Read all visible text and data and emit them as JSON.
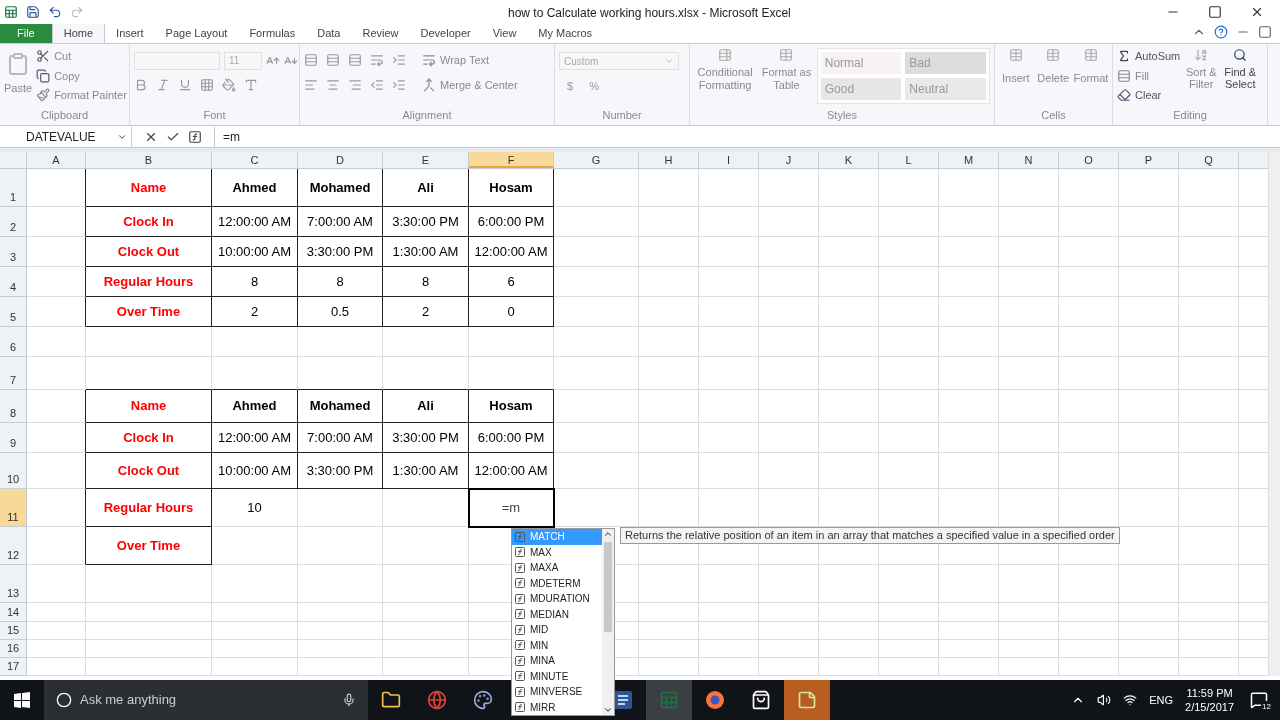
{
  "window": {
    "title": "how to Calculate working hours.xlsx - Microsoft Excel"
  },
  "tabs": [
    {
      "label": "File",
      "kind": "file",
      "selected": false
    },
    {
      "label": "Home",
      "kind": "tab",
      "selected": true
    },
    {
      "label": "Insert",
      "kind": "tab",
      "selected": false
    },
    {
      "label": "Page Layout",
      "kind": "tab",
      "selected": false
    },
    {
      "label": "Formulas",
      "kind": "tab",
      "selected": false
    },
    {
      "label": "Data",
      "kind": "tab",
      "selected": false
    },
    {
      "label": "Review",
      "kind": "tab",
      "selected": false
    },
    {
      "label": "Developer",
      "kind": "tab",
      "selected": false
    },
    {
      "label": "View",
      "kind": "tab",
      "selected": false
    },
    {
      "label": "My Macros",
      "kind": "tab",
      "selected": false
    }
  ],
  "ribbon": {
    "clipboard": {
      "label": "Clipboard",
      "paste": "Paste",
      "cut": "Cut",
      "copy": "Copy",
      "format_painter": "Format Painter"
    },
    "font": {
      "label": "Font",
      "size": "11"
    },
    "alignment": {
      "label": "Alignment",
      "wrap_text": "Wrap Text",
      "merge_center": "Merge & Center"
    },
    "number": {
      "label": "Number",
      "format": "Custom",
      "currency": "$",
      "percent": "%"
    },
    "styles": {
      "label": "Styles",
      "conditional_formatting": "Conditional Formatting",
      "format_as_table": "Format as Table",
      "cell_styles": [
        {
          "name": "Normal",
          "color": "#f8f2f2"
        },
        {
          "name": "Bad",
          "color": "#dcdcdc"
        },
        {
          "name": "Good",
          "color": "#e6e6e6"
        },
        {
          "name": "Neutral",
          "color": "#e9e9e9"
        }
      ]
    },
    "cells": {
      "label": "Cells",
      "buttons": [
        "Insert",
        "Delete",
        "Format"
      ]
    },
    "editing": {
      "label": "Editing",
      "autosum": "AutoSum",
      "fill": "Fill",
      "clear": "Clear",
      "sort_filter": "Sort & Filter",
      "find_select": "Find & Select"
    }
  },
  "formula_bar": {
    "name_box": "DATEVALUE",
    "formula": "=m"
  },
  "sheet": {
    "columns": [
      {
        "label": "A",
        "selected": false
      },
      {
        "label": "B",
        "selected": false
      },
      {
        "label": "C",
        "selected": false
      },
      {
        "label": "D",
        "selected": false
      },
      {
        "label": "E",
        "selected": false
      },
      {
        "label": "F",
        "selected": true
      },
      {
        "label": "G",
        "selected": false
      },
      {
        "label": "H",
        "selected": false
      },
      {
        "label": "I",
        "selected": false
      },
      {
        "label": "J",
        "selected": false
      },
      {
        "label": "K",
        "selected": false
      },
      {
        "label": "L",
        "selected": false
      },
      {
        "label": "M",
        "selected": false
      },
      {
        "label": "N",
        "selected": false
      },
      {
        "label": "O",
        "selected": false
      },
      {
        "label": "P",
        "selected": false
      },
      {
        "label": "Q",
        "selected": false
      }
    ],
    "rows": [
      {
        "number": "1",
        "selected": false,
        "cells": [
          {
            "kind": "none"
          },
          {
            "kind": "label",
            "text": "Name"
          },
          {
            "kind": "header",
            "text": "Ahmed"
          },
          {
            "kind": "header",
            "text": "Mohamed"
          },
          {
            "kind": "header",
            "text": "Ali"
          },
          {
            "kind": "header",
            "text": "Hosam"
          }
        ]
      },
      {
        "number": "2",
        "selected": false,
        "cells": [
          {
            "kind": "none"
          },
          {
            "kind": "label",
            "text": "Clock In"
          },
          {
            "kind": "value",
            "text": "12:00:00 AM"
          },
          {
            "kind": "value",
            "text": "7:00:00 AM"
          },
          {
            "kind": "value",
            "text": "3:30:00 PM"
          },
          {
            "kind": "value",
            "text": "6:00:00 PM"
          }
        ]
      },
      {
        "number": "3",
        "selected": false,
        "cells": [
          {
            "kind": "none"
          },
          {
            "kind": "label",
            "text": "Clock Out"
          },
          {
            "kind": "value",
            "text": "10:00:00 AM"
          },
          {
            "kind": "value",
            "text": "3:30:00 PM"
          },
          {
            "kind": "value",
            "text": "1:30:00 AM"
          },
          {
            "kind": "value",
            "text": "12:00:00 AM"
          }
        ]
      },
      {
        "number": "4",
        "selected": false,
        "cells": [
          {
            "kind": "none"
          },
          {
            "kind": "label",
            "text": "Regular Hours"
          },
          {
            "kind": "value",
            "text": "8"
          },
          {
            "kind": "value",
            "text": "8"
          },
          {
            "kind": "value",
            "text": "8"
          },
          {
            "kind": "value",
            "text": "6"
          }
        ]
      },
      {
        "number": "5",
        "selected": false,
        "cells": [
          {
            "kind": "none"
          },
          {
            "kind": "label",
            "text": "Over Time"
          },
          {
            "kind": "value",
            "text": "2"
          },
          {
            "kind": "value",
            "text": "0.5"
          },
          {
            "kind": "value",
            "text": "2"
          },
          {
            "kind": "value",
            "text": "0"
          }
        ]
      },
      {
        "number": "6",
        "selected": false,
        "cells": []
      },
      {
        "number": "7",
        "selected": false,
        "cells": []
      },
      {
        "number": "8",
        "selected": false,
        "cells": [
          {
            "kind": "none"
          },
          {
            "kind": "label",
            "text": "Name"
          },
          {
            "kind": "header",
            "text": "Ahmed"
          },
          {
            "kind": "header",
            "text": "Mohamed"
          },
          {
            "kind": "header",
            "text": "Ali"
          },
          {
            "kind": "header",
            "text": "Hosam"
          }
        ]
      },
      {
        "number": "9",
        "selected": false,
        "cells": [
          {
            "kind": "none"
          },
          {
            "kind": "label",
            "text": "Clock In"
          },
          {
            "kind": "value",
            "text": "12:00:00 AM"
          },
          {
            "kind": "value",
            "text": "7:00:00 AM"
          },
          {
            "kind": "value",
            "text": "3:30:00 PM"
          },
          {
            "kind": "value",
            "text": "6:00:00 PM"
          }
        ]
      },
      {
        "number": "10",
        "selected": false,
        "cells": [
          {
            "kind": "none"
          },
          {
            "kind": "label",
            "text": "Clock Out"
          },
          {
            "kind": "value",
            "text": "10:00:00 AM"
          },
          {
            "kind": "value",
            "text": "3:30:00 PM"
          },
          {
            "kind": "value",
            "text": "1:30:00 AM"
          },
          {
            "kind": "value",
            "text": "12:00:00 AM"
          }
        ]
      },
      {
        "number": "11",
        "selected": true,
        "cells": [
          {
            "kind": "none"
          },
          {
            "kind": "label",
            "text": "Regular Hours"
          },
          {
            "kind": "plain",
            "text": "10"
          },
          {
            "kind": "none"
          },
          {
            "kind": "none"
          },
          {
            "kind": "active",
            "text": "=m"
          }
        ]
      },
      {
        "number": "12",
        "selected": false,
        "cells": [
          {
            "kind": "none"
          },
          {
            "kind": "label",
            "text": "Over Time"
          }
        ]
      },
      {
        "number": "13",
        "selected": false,
        "cells": []
      },
      {
        "number": "14",
        "selected": false,
        "cells": []
      },
      {
        "number": "15",
        "selected": false,
        "cells": []
      },
      {
        "number": "16",
        "selected": false,
        "cells": []
      },
      {
        "number": "17",
        "selected": false,
        "cells": []
      }
    ]
  },
  "autocomplete": {
    "items": [
      {
        "label": "MATCH",
        "selected": true
      },
      {
        "label": "MAX",
        "selected": false
      },
      {
        "label": "MAXA",
        "selected": false
      },
      {
        "label": "MDETERM",
        "selected": false
      },
      {
        "label": "MDURATION",
        "selected": false
      },
      {
        "label": "MEDIAN",
        "selected": false
      },
      {
        "label": "MID",
        "selected": false
      },
      {
        "label": "MIN",
        "selected": false
      },
      {
        "label": "MINA",
        "selected": false
      },
      {
        "label": "MINUTE",
        "selected": false
      },
      {
        "label": "MINVERSE",
        "selected": false
      },
      {
        "label": "MIRR",
        "selected": false
      }
    ],
    "tooltip": "Returns the relative position of an item in an array that matches a specified value in a specified order"
  },
  "taskbar": {
    "search_placeholder": "Ask me anything",
    "apps": [
      {
        "kind": "folder",
        "selected": false
      },
      {
        "kind": "chrome",
        "selected": false
      },
      {
        "kind": "paint",
        "selected": false
      },
      {
        "kind": "word",
        "selected": false
      },
      {
        "kind": "excel",
        "selected": true
      },
      {
        "kind": "firefox",
        "selected": false
      },
      {
        "kind": "store",
        "selected": false
      },
      {
        "kind": "sticky",
        "selected": true
      }
    ],
    "language": "ENG",
    "time": "11:59 PM",
    "date": "2/15/2017",
    "notifications": "12"
  }
}
